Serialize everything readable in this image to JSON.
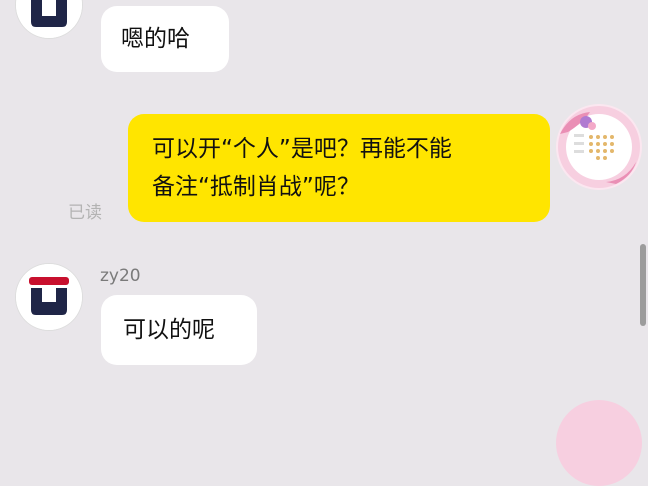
{
  "messages": [
    {
      "side": "in",
      "text": "嗯的哈"
    },
    {
      "side": "out",
      "text": "可以开“个人”是吧？再能不能\n备注“抵制肖战”呢？",
      "status": "已读"
    },
    {
      "side": "in",
      "sender": "zy20",
      "text": "可以的呢"
    }
  ],
  "colors": {
    "background": "#e9e6ea",
    "incoming_bubble": "#ffffff",
    "outgoing_bubble": "#ffe500",
    "logo_navy": "#1f2547",
    "logo_red": "#c8102e"
  },
  "icons": {
    "contact_avatar": "fila-logo-icon",
    "self_avatar": "pink-frame-avatar-icon"
  }
}
